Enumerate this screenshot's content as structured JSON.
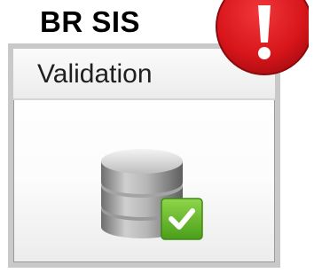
{
  "header": {
    "title": "BR SIS"
  },
  "tile": {
    "label": "Validation",
    "icon": "database-check-icon"
  },
  "alert": {
    "icon": "exclamation-alert-icon",
    "glyph": "!",
    "color": "#d8161b"
  },
  "colors": {
    "check_green": "#6cbe2a",
    "database_gray": "#8e8e8e"
  }
}
